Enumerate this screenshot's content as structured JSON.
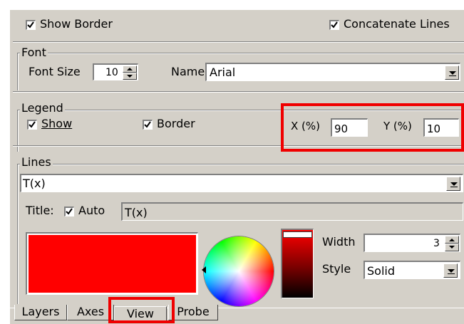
{
  "display": {
    "show_border_label": "Show Border",
    "show_border_checked": true,
    "concat_lines_label": "Concatenate Lines",
    "concat_lines_checked": true
  },
  "font": {
    "group_label": "Font",
    "size_label": "Font Size",
    "size_value": "10",
    "name_label": "Name",
    "name_value": "Arial"
  },
  "legend": {
    "group_label": "Legend",
    "show_label": "Show",
    "show_checked": true,
    "border_label": "Border",
    "border_checked": true,
    "x_label": "X (%)",
    "x_value": "90",
    "y_label": "Y (%)",
    "y_value": "10"
  },
  "lines": {
    "group_label": "Lines",
    "selected_line": "T(x)",
    "title_label": "Title:",
    "auto_label": "Auto",
    "auto_checked": true,
    "title_value": "T(x)",
    "swatch_color": "#ff0000",
    "width_label": "Width",
    "width_value": "3",
    "style_label": "Style",
    "style_value": "Solid"
  },
  "tabs": [
    {
      "label": "Layers",
      "active": false
    },
    {
      "label": "Axes",
      "active": false
    },
    {
      "label": "View",
      "active": true
    },
    {
      "label": "Probe",
      "active": false
    }
  ],
  "highlight_color": "#f00000"
}
